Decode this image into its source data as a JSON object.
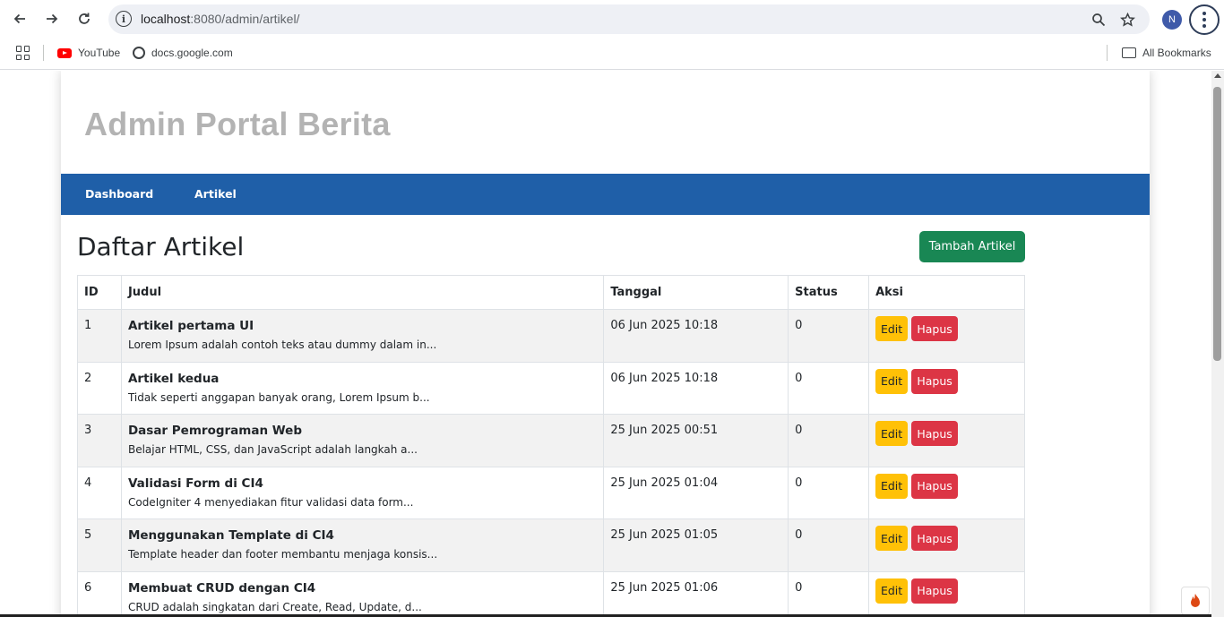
{
  "browser": {
    "back_icon": "arrow-left-icon",
    "forward_icon": "arrow-right-icon",
    "reload_icon": "reload-icon",
    "url_host": "localhost",
    "url_rest": ":8080/admin/artikel/",
    "profile_initial": "N"
  },
  "bookmarks": {
    "items": [
      {
        "label": "YouTube"
      },
      {
        "label": "docs.google.com"
      }
    ],
    "all_bookmarks": "All Bookmarks"
  },
  "site": {
    "title": "Admin Portal Berita",
    "nav": [
      {
        "label": "Dashboard"
      },
      {
        "label": "Artikel"
      }
    ]
  },
  "page": {
    "heading": "Daftar Artikel",
    "add_button": "Tambah Artikel"
  },
  "table": {
    "headers": [
      "ID",
      "Judul",
      "Tanggal",
      "Status",
      "Aksi"
    ],
    "edit_label": "Edit",
    "delete_label": "Hapus",
    "rows": [
      {
        "id": "1",
        "title": "Artikel pertama UI",
        "excerpt": "Lorem Ipsum adalah contoh teks atau dummy dalam in...",
        "date": "06 Jun 2025 10:18",
        "status": "0"
      },
      {
        "id": "2",
        "title": "Artikel kedua",
        "excerpt": "Tidak seperti anggapan banyak orang, Lorem Ipsum b...",
        "date": "06 Jun 2025 10:18",
        "status": "0"
      },
      {
        "id": "3",
        "title": "Dasar Pemrograman Web",
        "excerpt": "Belajar HTML, CSS, dan JavaScript adalah langkah a...",
        "date": "25 Jun 2025 00:51",
        "status": "0"
      },
      {
        "id": "4",
        "title": "Validasi Form di CI4",
        "excerpt": "CodeIgniter 4 menyediakan fitur validasi data form...",
        "date": "25 Jun 2025 01:04",
        "status": "0"
      },
      {
        "id": "5",
        "title": "Menggunakan Template di CI4",
        "excerpt": "Template header dan footer membantu menjaga konsis...",
        "date": "25 Jun 2025 01:05",
        "status": "0"
      },
      {
        "id": "6",
        "title": "Membuat CRUD dengan CI4",
        "excerpt": "CRUD adalah singkatan dari Create, Read, Update, d...",
        "date": "25 Jun 2025 01:06",
        "status": "0"
      }
    ]
  },
  "colors": {
    "navbar": "#1f5fa8",
    "add_button": "#198754",
    "edit_button": "#ffc107",
    "delete_button": "#dc3545"
  }
}
